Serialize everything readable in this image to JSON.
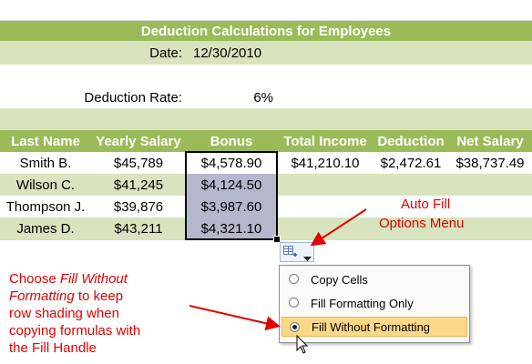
{
  "sheet": {
    "title": "Deduction Calculations for Employees",
    "date_label": "Date:",
    "date_value": "12/30/2010",
    "rate_label": "Deduction Rate:",
    "rate_value": "6%",
    "headers": [
      "Last Name",
      "Yearly Salary",
      "Bonus",
      "Total Income",
      "Deduction",
      "Net Salary"
    ],
    "rows": [
      {
        "name": "Smith B.",
        "salary": "$45,789",
        "bonus": "$4,578.90",
        "total": "$41,210.10",
        "deduction": "$2,472.61",
        "net": "$38,737.49"
      },
      {
        "name": "Wilson C.",
        "salary": "$41,245",
        "bonus": "$4,124.50",
        "total": "",
        "deduction": "",
        "net": ""
      },
      {
        "name": "Thompson J.",
        "salary": "$39,876",
        "bonus": "$3,987.60",
        "total": "",
        "deduction": "",
        "net": ""
      },
      {
        "name": "James D.",
        "salary": "$43,211",
        "bonus": "$4,321.10",
        "total": "",
        "deduction": "",
        "net": ""
      }
    ]
  },
  "annotations": {
    "auto_fill_line1": "Auto Fill",
    "auto_fill_line2": "Options Menu",
    "note_line1": "Choose ",
    "note_em1": "Fill Without",
    "note_em2": "Formatting",
    "note_line2_rest": " to keep",
    "note_line3": "row shading when",
    "note_line4": "copying formulas with",
    "note_line5": "the Fill Handle"
  },
  "menu": {
    "items": [
      {
        "label": "Copy Cells",
        "selected": false
      },
      {
        "label": "Fill Formatting Only",
        "selected": false
      },
      {
        "label": "Fill Without Formatting",
        "selected": true
      }
    ]
  },
  "colors": {
    "accent": "#9bbb59",
    "annotation": "#e00000",
    "selection": "#b4b8cc"
  },
  "icons": {
    "options_button": "auto-fill-options-icon",
    "cursor": "mouse-pointer-icon"
  }
}
